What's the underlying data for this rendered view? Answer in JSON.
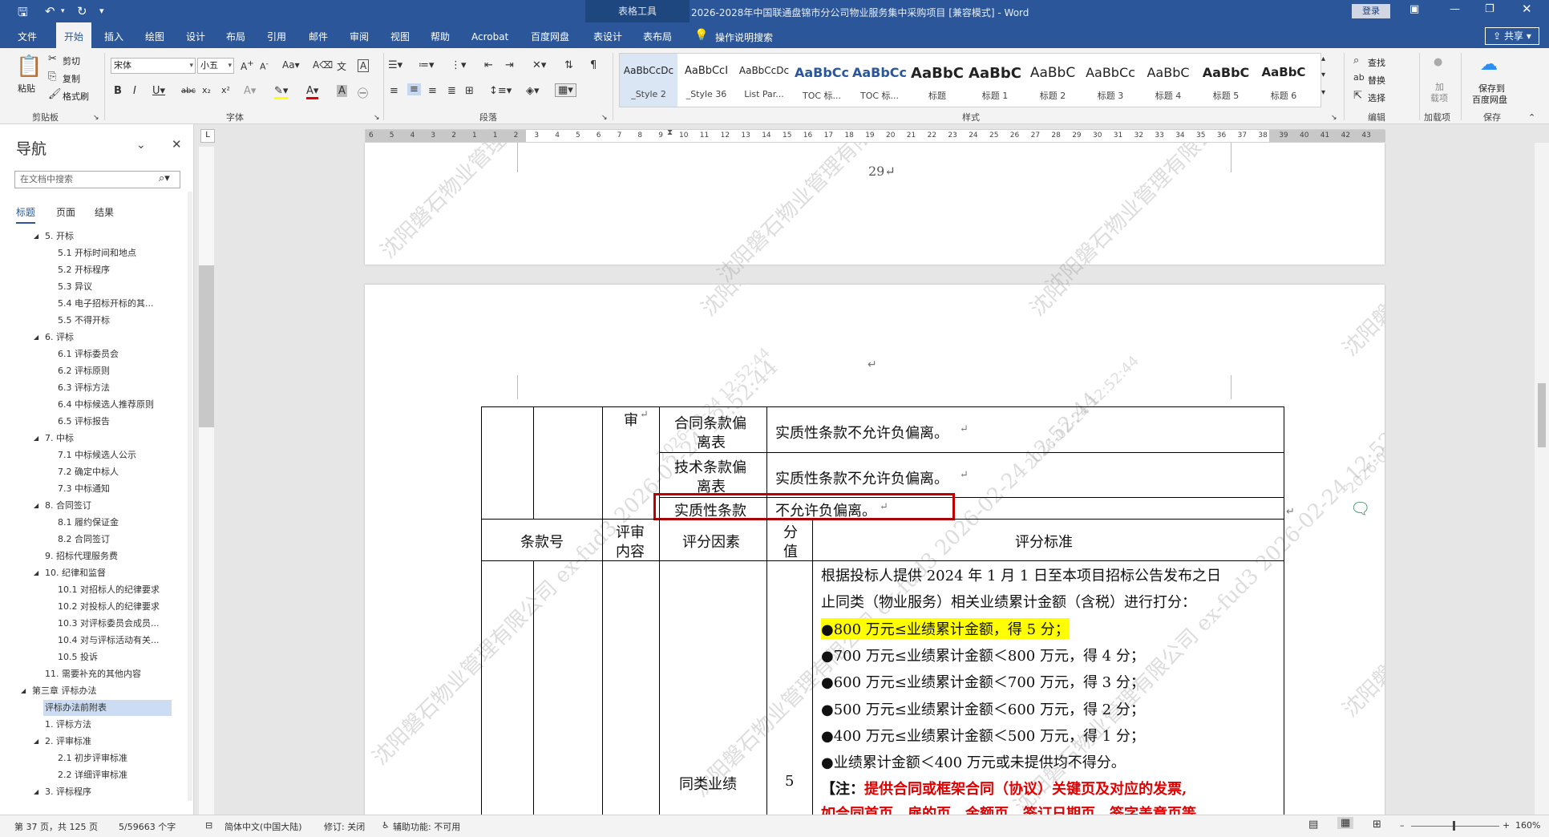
{
  "title_bar": {
    "context_tab": "表格工具",
    "document_title": "2026-2028年中国联通盘锦市分公司物业服务集中采购项目 [兼容模式] - Word",
    "login": "登录"
  },
  "tabs": [
    "文件",
    "开始",
    "插入",
    "绘图",
    "设计",
    "布局",
    "引用",
    "邮件",
    "审阅",
    "视图",
    "帮助",
    "Acrobat",
    "百度网盘",
    "表设计",
    "表布局"
  ],
  "active_tab": "开始",
  "tell_me": "操作说明搜索",
  "share": "共享",
  "ribbon": {
    "clipboard": {
      "paste": "粘贴",
      "cut": "剪切",
      "copy": "复制",
      "format_painter": "格式刷",
      "label": "剪贴板"
    },
    "font": {
      "name": "宋体",
      "size": "小五",
      "label": "字体"
    },
    "paragraph": {
      "label": "段落"
    },
    "styles": {
      "label": "样式",
      "items": [
        {
          "preview": "AaBbCcDc",
          "name": "_Style 2"
        },
        {
          "preview": "AaBbCcI",
          "name": "_Style 36"
        },
        {
          "preview": "AaBbCcDc",
          "name": "List Par..."
        },
        {
          "preview": "AaBbCc",
          "name": "TOC 标..."
        },
        {
          "preview": "AaBbCc",
          "name": "TOC 标..."
        },
        {
          "preview": "AaBbC",
          "name": "标题"
        },
        {
          "preview": "AaBbC",
          "name": "标题 1"
        },
        {
          "preview": "AaBbC",
          "name": "标题 2"
        },
        {
          "preview": "AaBbCc",
          "name": "标题 3"
        },
        {
          "preview": "AaBbC",
          "name": "标题 4"
        },
        {
          "preview": "AaBbC",
          "name": "标题 5"
        },
        {
          "preview": "AaBbC",
          "name": "标题 6"
        }
      ]
    },
    "editing": {
      "find": "查找",
      "replace": "替换",
      "select": "选择",
      "label": "编辑"
    },
    "addins": {
      "line1": "加",
      "line2": "载项",
      "label": "加载项"
    },
    "save": {
      "line1": "保存到",
      "line2": "百度网盘",
      "label": "保存"
    }
  },
  "nav": {
    "title": "导航",
    "search_placeholder": "在文档中搜索",
    "tabs": [
      "标题",
      "页面",
      "结果"
    ],
    "items": [
      {
        "label": "5. 开标",
        "level": 1,
        "arrow": "◢"
      },
      {
        "label": "5.1 开标时间和地点",
        "level": 2
      },
      {
        "label": "5.2 开标程序",
        "level": 2
      },
      {
        "label": "5.3 异议",
        "level": 2
      },
      {
        "label": "5.4 电子招标开标的其...",
        "level": 2
      },
      {
        "label": "5.5 不得开标",
        "level": 2
      },
      {
        "label": "6. 评标",
        "level": 1,
        "arrow": "◢"
      },
      {
        "label": "6.1 评标委员会",
        "level": 2
      },
      {
        "label": "6.2 评标原则",
        "level": 2
      },
      {
        "label": "6.3 评标方法",
        "level": 2
      },
      {
        "label": "6.4 中标候选人推荐原则",
        "level": 2
      },
      {
        "label": "6.5 评标报告",
        "level": 2
      },
      {
        "label": "7. 中标",
        "level": 1,
        "arrow": "◢"
      },
      {
        "label": "7.1 中标候选人公示",
        "level": 2
      },
      {
        "label": "7.2 确定中标人",
        "level": 2
      },
      {
        "label": "7.3 中标通知",
        "level": 2
      },
      {
        "label": "8. 合同签订",
        "level": 1,
        "arrow": "◢"
      },
      {
        "label": "8.1 履约保证金",
        "level": 2
      },
      {
        "label": "8.2 合同签订",
        "level": 2
      },
      {
        "label": "9. 招标代理服务费",
        "level": 1
      },
      {
        "label": "10. 纪律和监督",
        "level": 1,
        "arrow": "◢"
      },
      {
        "label": "10.1 对招标人的纪律要求",
        "level": 2
      },
      {
        "label": "10.2 对投标人的纪律要求",
        "level": 2
      },
      {
        "label": "10.3 对评标委员会成员...",
        "level": 2
      },
      {
        "label": "10.4 对与评标活动有关...",
        "level": 2
      },
      {
        "label": "10.5 投诉",
        "level": 2
      },
      {
        "label": "11. 需要补充的其他内容",
        "level": 1
      },
      {
        "label": "第三章 评标办法",
        "level": 0,
        "arrow": "◢"
      },
      {
        "label": "评标办法前附表",
        "level": 1,
        "selected": true
      },
      {
        "label": "1. 评标方法",
        "level": 1
      },
      {
        "label": "2. 评审标准",
        "level": 1,
        "arrow": "◢"
      },
      {
        "label": "2.1 初步评审标准",
        "level": 2
      },
      {
        "label": "2.2 详细评审标准",
        "level": 2
      },
      {
        "label": "3. 评标程序",
        "level": 1,
        "arrow": "◢"
      }
    ]
  },
  "ruler_numbers": [
    "6",
    "5",
    "4",
    "3",
    "2",
    "1",
    "1",
    "2",
    "3",
    "4",
    "5",
    "6",
    "7",
    "8",
    "9",
    "10",
    "11",
    "12",
    "13",
    "14",
    "15",
    "16",
    "17",
    "18",
    "19",
    "20",
    "21",
    "22",
    "23",
    "24",
    "25",
    "26",
    "27",
    "28",
    "29",
    "30",
    "31",
    "32",
    "33",
    "34",
    "35",
    "36",
    "37",
    "38",
    "39",
    "40",
    "41",
    "42",
    "43"
  ],
  "document": {
    "page_number": "29",
    "watermark_company": "沈阳磐石物业管理有限公司",
    "watermark_time": "2026-02-24 12:52:44",
    "watermark_full": "沈阳磐石物业管理有限公司 ex-fud3 2026-02-24 12:52:44",
    "table": {
      "shen": "审",
      "rows_top": [
        {
          "factor": [
            "合同条款偏",
            "离表"
          ],
          "standard": "实质性条款不允许负偏离。"
        },
        {
          "factor": [
            "技术条款偏",
            "离表"
          ],
          "standard": "实质性条款不允许负偏离。"
        },
        {
          "factor": [
            "实质性条款"
          ],
          "standard": "不允许负偏离。"
        }
      ],
      "header": {
        "clause_no": "条款号",
        "content": [
          "评审",
          "内容"
        ],
        "factor": "评分因素",
        "score": [
          "分",
          "值"
        ],
        "standard": "评分标准"
      },
      "perf": {
        "factor": "同类业绩",
        "score": "5",
        "lines": [
          "根据投标人提供 2024 年 1 月 1 日至本项目招标公告发布之日",
          "止同类（物业服务）相关业绩累计金额（含税）进行打分：",
          "●800 万元≤业绩累计金额，得 5 分；",
          "●700 万元≤业绩累计金额＜800 万元，得 4 分；",
          "●600 万元≤业绩累计金额＜700 万元，得 3 分；",
          "●500 万元≤业绩累计金额＜600 万元，得 2 分；",
          "●400 万元≤业绩累计金额＜500 万元，得 1 分；",
          "●业绩累计金额＜400 万元或未提供均不得分。"
        ],
        "note_prefix": "【注：",
        "note_red": "提供合同或框架合同（协议）关键页及对应的发票,",
        "cut_line": "如合同首页、扉的页、金额页、签订日期页、签字盖章页等"
      }
    }
  },
  "status": {
    "page": "第 37 页，共 125 页",
    "words": "5/59663 个字",
    "language": "简体中文(中国大陆)",
    "track": "修订: 关闭",
    "accessibility": "辅助功能: 不可用",
    "zoom": "160%"
  },
  "colors": {
    "accent": "#2b579a",
    "highlight": "#ffff00",
    "red_text": "#e00000",
    "callout_border": "#c00000"
  }
}
